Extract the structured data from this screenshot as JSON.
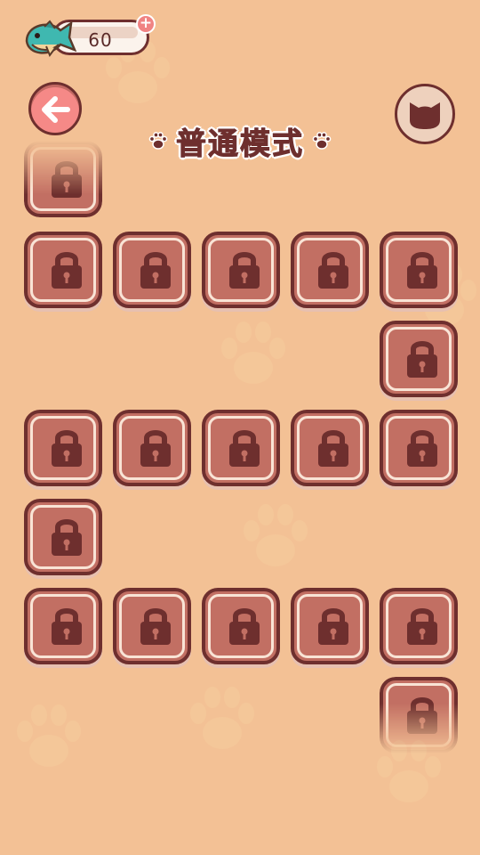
{
  "header": {
    "currency_amount": "60",
    "currency_icon": "fish-icon",
    "add_icon": "plus-icon",
    "back_icon": "arrow-left-icon",
    "profile_icon": "cat-head-icon",
    "title": "普通模式"
  },
  "levels": {
    "state": "locked",
    "icon": "lock-icon",
    "count": 20
  },
  "colors": {
    "background": "#f3c195",
    "tile_fill": "#c26f63",
    "tile_border": "#6e2f2e",
    "back_button": "#f58987",
    "fish": "#3fb8b0"
  }
}
